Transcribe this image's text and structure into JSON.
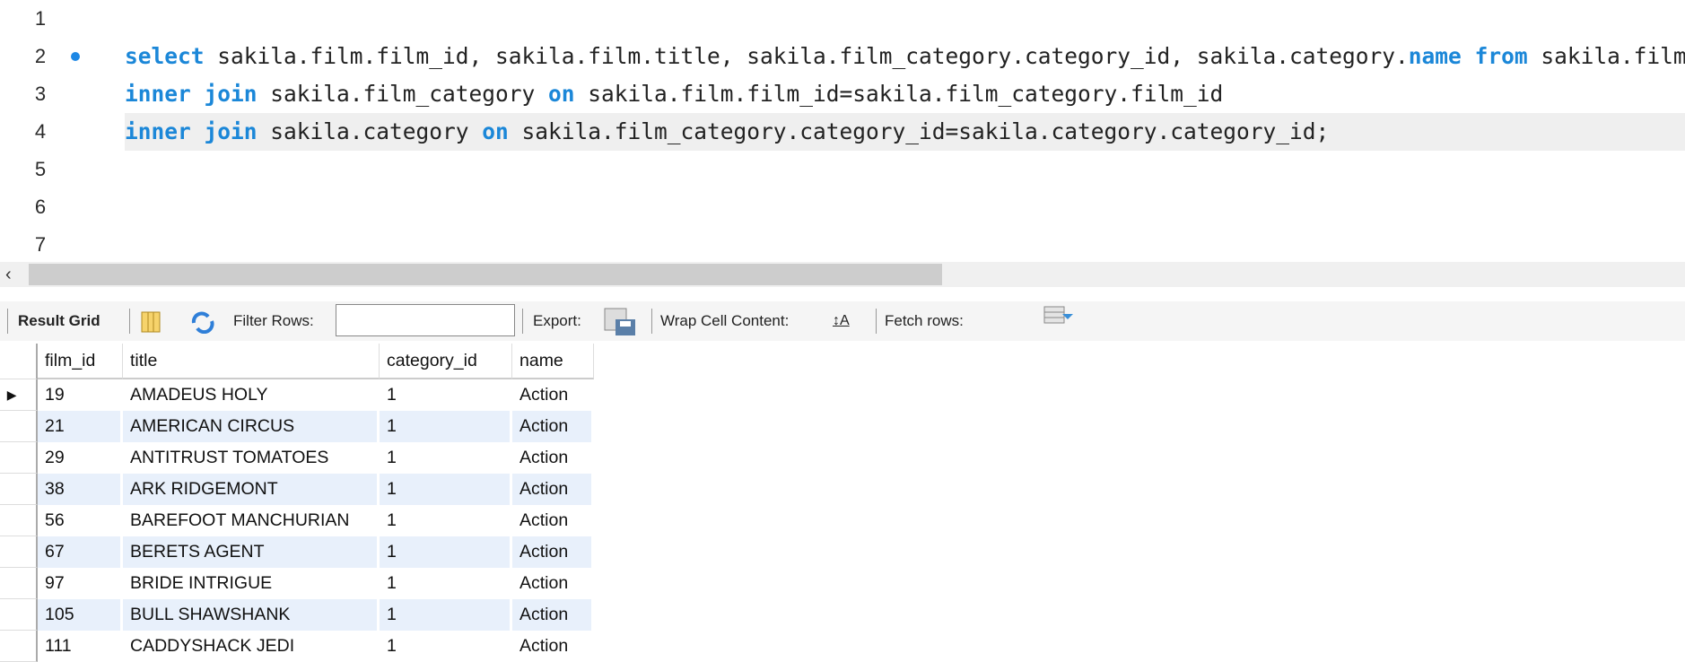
{
  "editor": {
    "lines": [
      {
        "num": "1",
        "tokens": []
      },
      {
        "num": "2",
        "tokens": [
          [
            "kw",
            "select"
          ],
          [
            "t",
            " sakila.film.film_id, sakila.film.title, sakila.film_category.category_id, sakila.category."
          ],
          [
            "kw",
            "name"
          ],
          [
            "t",
            " "
          ],
          [
            "kw",
            "from"
          ],
          [
            "t",
            " sakila.film"
          ]
        ]
      },
      {
        "num": "3",
        "tokens": [
          [
            "kw",
            "inner join"
          ],
          [
            "t",
            " sakila.film_category "
          ],
          [
            "kw",
            "on"
          ],
          [
            "t",
            " sakila.film.film_id=sakila.film_category.film_id"
          ]
        ]
      },
      {
        "num": "4",
        "tokens": [
          [
            "kw",
            "inner join"
          ],
          [
            "t",
            " sakila.category "
          ],
          [
            "kw",
            "on"
          ],
          [
            "t",
            " sakila.film_category.category_id=sakila.category.category_id;"
          ]
        ]
      },
      {
        "num": "5",
        "tokens": []
      },
      {
        "num": "6",
        "tokens": []
      },
      {
        "num": "7",
        "tokens": []
      }
    ]
  },
  "toolbar": {
    "result_grid": "Result Grid",
    "filter_rows": "Filter Rows:",
    "filter_value": "",
    "export": "Export:",
    "wrap": "Wrap Cell Content:",
    "fetch": "Fetch rows:"
  },
  "grid": {
    "columns": [
      "film_id",
      "title",
      "category_id",
      "name"
    ],
    "rows": [
      [
        "19",
        "AMADEUS HOLY",
        "1",
        "Action"
      ],
      [
        "21",
        "AMERICAN CIRCUS",
        "1",
        "Action"
      ],
      [
        "29",
        "ANTITRUST TOMATOES",
        "1",
        "Action"
      ],
      [
        "38",
        "ARK RIDGEMONT",
        "1",
        "Action"
      ],
      [
        "56",
        "BAREFOOT MANCHURIAN",
        "1",
        "Action"
      ],
      [
        "67",
        "BERETS AGENT",
        "1",
        "Action"
      ],
      [
        "97",
        "BRIDE INTRIGUE",
        "1",
        "Action"
      ],
      [
        "105",
        "BULL SHAWSHANK",
        "1",
        "Action"
      ],
      [
        "111",
        "CADDYSHACK JEDI",
        "1",
        "Action"
      ]
    ]
  }
}
